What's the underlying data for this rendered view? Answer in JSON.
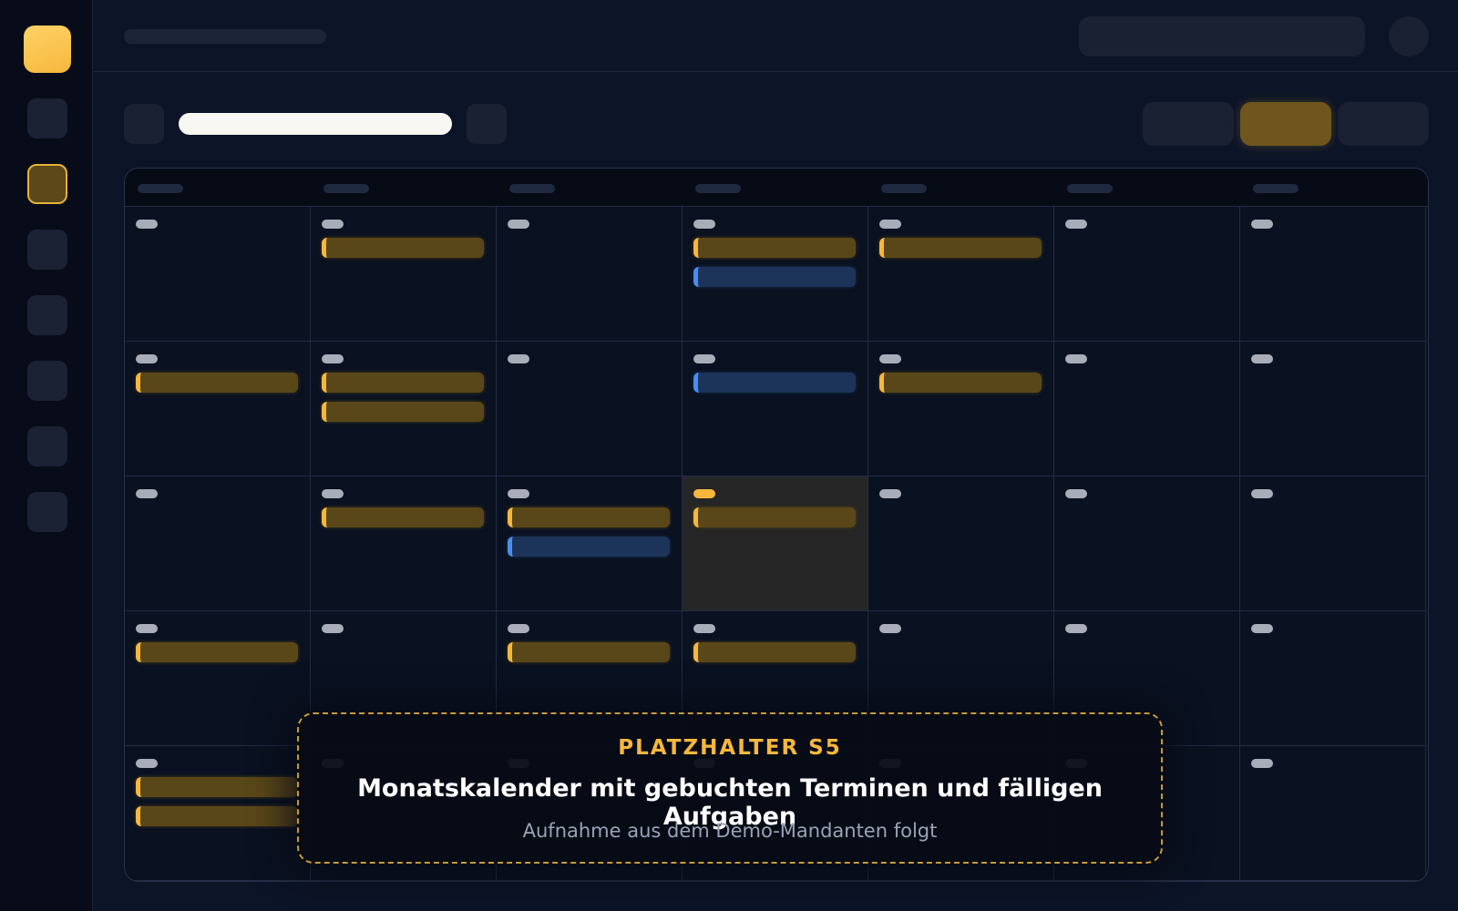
{
  "placeholder": {
    "tag": "PLATZHALTER S5",
    "title": "Monatskalender mit gebuchten Terminen und fälligen Aufgaben",
    "subtitle": "Aufnahme aus dem Demo-Mandanten folgt"
  },
  "colors": {
    "accent": "#f6b73c",
    "appointment": "#5a4719",
    "task": "#1c3459",
    "background": "#0c1427"
  },
  "calendar": {
    "weeks": [
      [
        [],
        [
          "appointment"
        ],
        [],
        [
          "appointment",
          "task"
        ],
        [
          "appointment"
        ],
        [],
        []
      ],
      [
        [
          "appointment"
        ],
        [
          "appointment",
          "appointment"
        ],
        [],
        [
          "task"
        ],
        [
          "appointment"
        ],
        [],
        []
      ],
      [
        [],
        [
          "appointment"
        ],
        [
          "appointment",
          "task"
        ],
        [
          "appointment"
        ],
        [],
        [],
        []
      ],
      [
        [
          "appointment"
        ],
        [],
        [
          "appointment"
        ],
        [
          "appointment"
        ],
        [],
        [],
        []
      ],
      [
        [
          "appointment",
          "appointment"
        ],
        [],
        [],
        [],
        [],
        [],
        []
      ]
    ],
    "today": [
      2,
      3
    ]
  },
  "icons": {
    "logo": "app-logo",
    "nav": [
      "nav-1-icon",
      "calendar-icon",
      "nav-3-icon",
      "nav-4-icon",
      "nav-5-icon",
      "nav-6-icon",
      "nav-7-icon"
    ]
  }
}
